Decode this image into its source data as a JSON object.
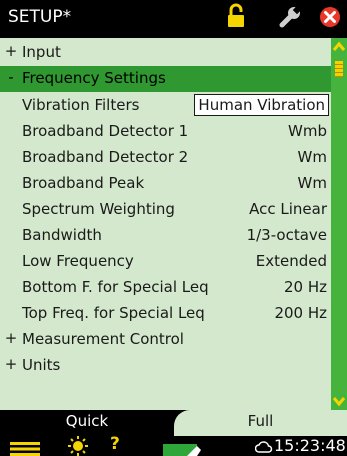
{
  "title": "SETUP*",
  "colors": {
    "list_bg": "#d3e8cc",
    "highlight": "#2f9830",
    "scrollbar": "#46b43c",
    "accent_yellow": "#f6d400",
    "close_red": "#e8382a"
  },
  "rows": [
    {
      "type": "group",
      "sign": "+",
      "label": "Input",
      "highlighted": false
    },
    {
      "type": "group",
      "sign": "-",
      "label": "Frequency Settings",
      "highlighted": true
    },
    {
      "type": "setting",
      "label": "Vibration Filters",
      "value": "Human Vibration",
      "selected": true
    },
    {
      "type": "setting",
      "label": "Broadband Detector 1",
      "value": "Wmb"
    },
    {
      "type": "setting",
      "label": "Broadband Detector 2",
      "value": "Wm"
    },
    {
      "type": "setting",
      "label": "Broadband Peak",
      "value": "Wm"
    },
    {
      "type": "setting",
      "label": "Spectrum Weighting",
      "value": "Acc Linear"
    },
    {
      "type": "setting",
      "label": "Bandwidth",
      "value": "1/3-octave"
    },
    {
      "type": "setting",
      "label": "Low Frequency",
      "value": "Extended"
    },
    {
      "type": "setting",
      "label": "Bottom F. for Special Leq",
      "value": "20 Hz"
    },
    {
      "type": "setting",
      "label": "Top Freq. for Special Leq",
      "value": "200 Hz"
    },
    {
      "type": "group",
      "sign": "+",
      "label": "Measurement Control",
      "highlighted": false
    },
    {
      "type": "group",
      "sign": "+",
      "label": "Units",
      "highlighted": false
    }
  ],
  "tabs": {
    "quick": "Quick",
    "full": "Full",
    "active": "full"
  },
  "status": {
    "help": "?",
    "time": "15:23:48",
    "icons": [
      "menu-icon",
      "sun-icon",
      "help-icon",
      "battery-icon",
      "cloud-icon"
    ]
  }
}
